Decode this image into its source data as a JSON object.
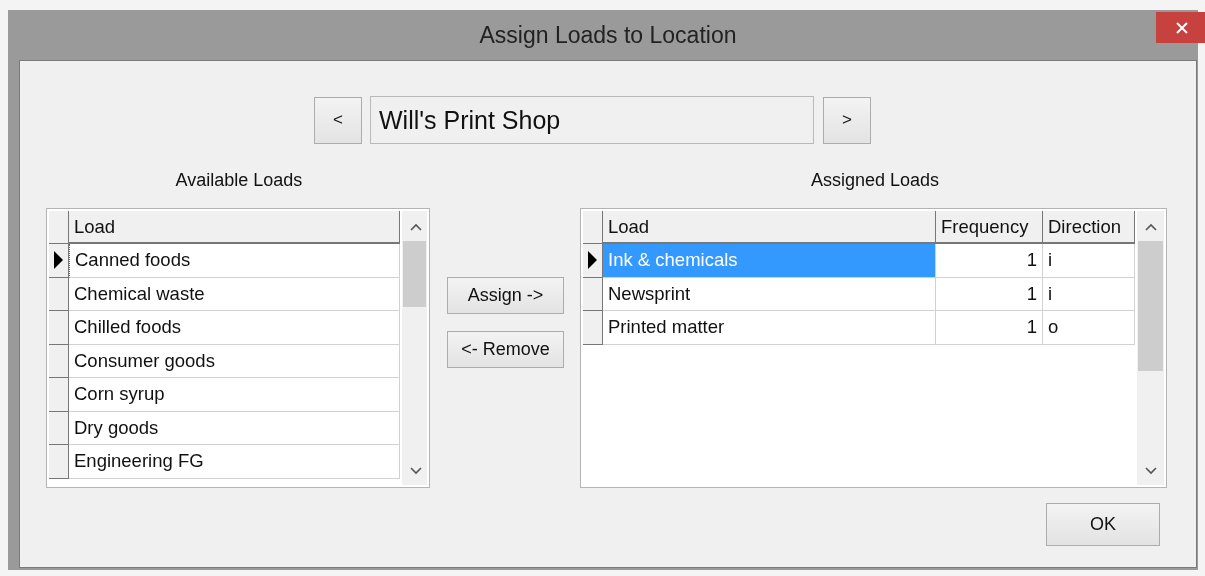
{
  "window": {
    "title": "Assign Loads to Location"
  },
  "navigator": {
    "prev": "<",
    "location": "Will's Print Shop",
    "next": ">"
  },
  "available": {
    "title": "Available Loads",
    "columns": [
      "Load"
    ],
    "rows": [
      {
        "load": "Canned foods",
        "current": true
      },
      {
        "load": "Chemical waste",
        "current": false
      },
      {
        "load": "Chilled foods",
        "current": false
      },
      {
        "load": "Consumer goods",
        "current": false
      },
      {
        "load": "Corn syrup",
        "current": false
      },
      {
        "load": "Dry goods",
        "current": false
      },
      {
        "load": "Engineering FG",
        "current": false
      }
    ]
  },
  "buttons": {
    "assign": "Assign ->",
    "remove": "<- Remove",
    "ok": "OK"
  },
  "assigned": {
    "title": "Assigned Loads",
    "columns": [
      "Load",
      "Frequency",
      "Direction"
    ],
    "rows": [
      {
        "load": "Ink & chemicals",
        "frequency": "1",
        "direction": "i",
        "current": true,
        "selected": true
      },
      {
        "load": "Newsprint",
        "frequency": "1",
        "direction": "i",
        "current": false,
        "selected": false
      },
      {
        "load": "Printed matter",
        "frequency": "1",
        "direction": "o",
        "current": false,
        "selected": false
      }
    ]
  }
}
